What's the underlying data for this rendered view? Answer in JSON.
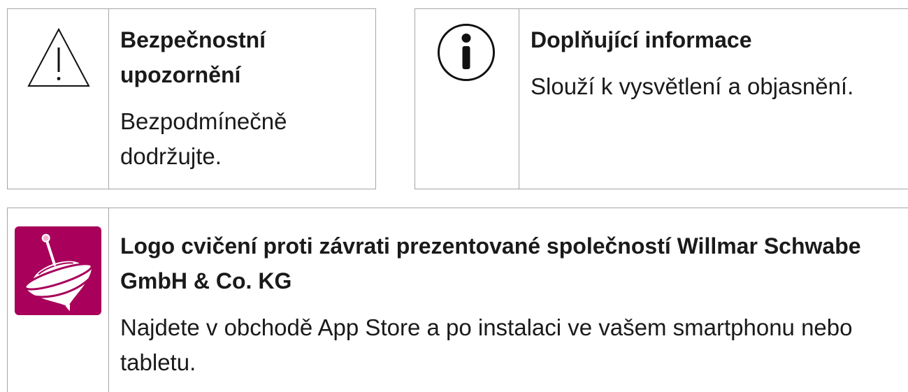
{
  "cards": [
    {
      "icon": "warning-triangle-icon",
      "heading": "Bezpečnostní upozornění",
      "body": "Bezpodmínečně dodržujte."
    },
    {
      "icon": "info-icon",
      "heading": "Doplňující informace",
      "body": "Slouží k vysvětlení a objasnění."
    },
    {
      "icon": "spinning-top-app-icon",
      "heading": "Logo cvičení proti závrati prezentované společností Willmar Schwabe GmbH & Co. KG",
      "body": "Najdete v obchodě App Store a po instalaci ve vašem smartphonu nebo tabletu."
    }
  ],
  "colors": {
    "border": "#a6a6a6",
    "text": "#1a1a1a",
    "icon_line": "#111111",
    "app_icon_background": "#a8005b",
    "app_icon_knob": "#f2b3d1"
  }
}
